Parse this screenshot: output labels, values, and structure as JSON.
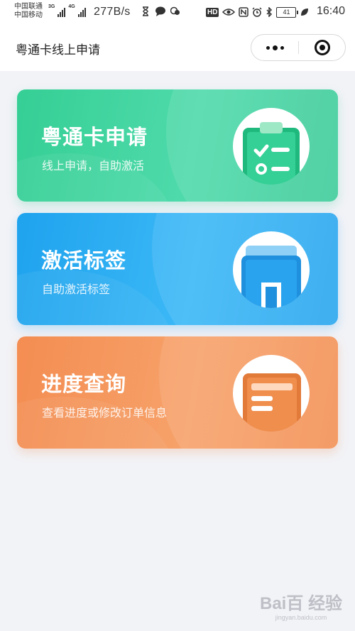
{
  "status_bar": {
    "carrier_1": "中国联通",
    "carrier_2": "中国移动",
    "net_1": "3G",
    "net_2": "4G",
    "speed": "277B/s",
    "hd_badge": "HD",
    "battery": "41",
    "time": "16:40"
  },
  "nav": {
    "title": "粤通卡线上申请"
  },
  "cards": [
    {
      "title": "粤通卡申请",
      "subtitle": "线上申请，自助激活",
      "icon": "clipboard-checklist-icon",
      "color": "#35cf95"
    },
    {
      "title": "激活标签",
      "subtitle": "自助激活标签",
      "icon": "tag-device-icon",
      "color": "#1fa3ee"
    },
    {
      "title": "进度查询",
      "subtitle": "查看进度或修改订单信息",
      "icon": "document-list-icon",
      "color": "#f48d52"
    }
  ],
  "watermark": {
    "logo": "Bai百 经验",
    "url": "jingyan.baidu.com"
  }
}
